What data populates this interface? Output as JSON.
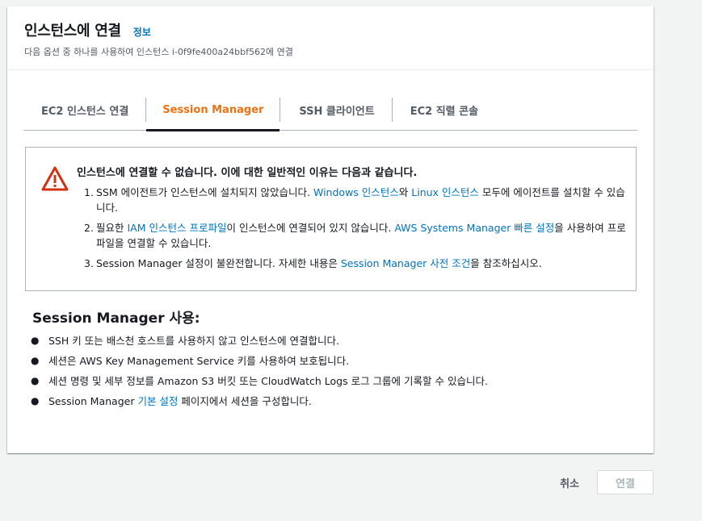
{
  "header": {
    "title": "인스턴스에 연결",
    "info_link": "정보",
    "subtitle": "다음 옵션 중 하나를 사용하여 인스턴스 i-0f9fe400a24bbf562에 연결"
  },
  "tabs": [
    {
      "label": "EC2 인스턴스 연결",
      "active": false
    },
    {
      "label": "Session Manager",
      "active": true
    },
    {
      "label": "SSH 클라이언트",
      "active": false
    },
    {
      "label": "EC2 직렬 콘솔",
      "active": false
    }
  ],
  "alert": {
    "icon": "warning-icon",
    "title": "인스턴스에 연결할 수 없습니다. 이에 대한 일반적인 이유는 다음과 같습니다.",
    "items": [
      {
        "num": "1.",
        "pre": "SSM 에이전트가 인스턴스에 설치되지 않았습니다. ",
        "link1": "Windows 인스턴스",
        "mid": "와 ",
        "link2": "Linux 인스턴스",
        "post": " 모두에 에이전트를 설치할 수 있습니다."
      },
      {
        "num": "2.",
        "pre": "필요한 ",
        "link1": "IAM 인스턴스 프로파일",
        "mid": "이 인스턴스에 연결되어 있지 않습니다. ",
        "link2": "AWS Systems Manager 빠른 설정",
        "post": "을 사용하여 프로파일을 연결할 수 있습니다."
      },
      {
        "num": "3.",
        "pre": "Session Manager 설정이 불완전합니다. 자세한 내용은 ",
        "link1": "Session Manager 사전 조건",
        "post": "을 참조하십시오."
      }
    ]
  },
  "usage": {
    "title": "Session Manager 사용:",
    "items": [
      {
        "text": "SSH 키 또는 배스천 호스트를 사용하지 않고 인스턴스에 연결합니다."
      },
      {
        "text": "세션은 AWS Key Management Service 키를 사용하여 보호됩니다."
      },
      {
        "text": "세션 명령 및 세부 정보를 Amazon S3 버킷 또는 CloudWatch Logs 로그 그룹에 기록할 수 있습니다."
      },
      {
        "pre": "Session Manager ",
        "link": "기본 설정",
        "post": " 페이지에서 세션을 구성합니다."
      }
    ]
  },
  "footer": {
    "cancel_label": "취소",
    "connect_label": "연결",
    "connect_disabled": true
  },
  "colors": {
    "accent_tab": "#ec7211",
    "link": "#0073bb",
    "warning": "#d13212"
  }
}
